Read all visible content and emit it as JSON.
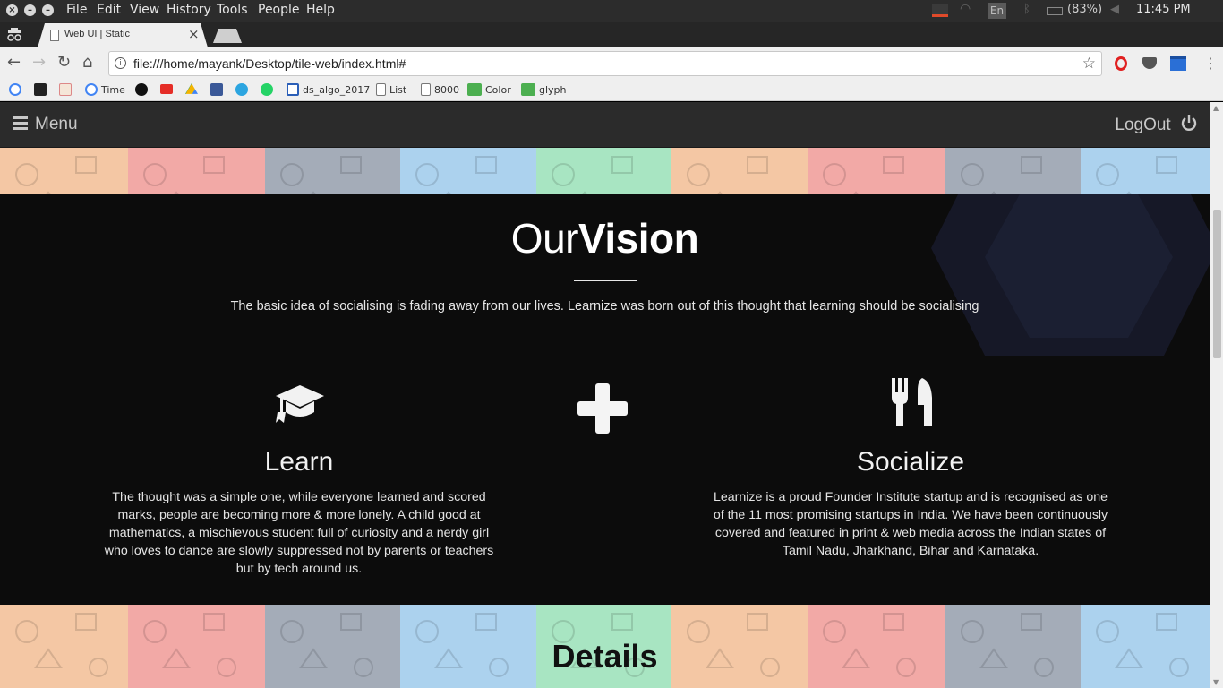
{
  "os_bar": {
    "menu": [
      "File",
      "Edit",
      "View",
      "History",
      "Tools",
      "People",
      "Help"
    ],
    "keyboard_layout": "En",
    "battery": "(83%)",
    "clock": "11:45 PM"
  },
  "browser": {
    "tab_title": "Web UI | Static",
    "url": "file:///home/mayank/Desktop/tile-web/index.html#",
    "bookmarks": [
      {
        "label": "",
        "icon": "google-icon"
      },
      {
        "label": "",
        "icon": "bookmark-slash-icon"
      },
      {
        "label": "",
        "icon": "backpack-icon"
      },
      {
        "label": "Time",
        "icon": "google-icon"
      },
      {
        "label": "",
        "icon": "github-icon"
      },
      {
        "label": "",
        "icon": "youtube-icon"
      },
      {
        "label": "",
        "icon": "drive-icon"
      },
      {
        "label": "",
        "icon": "facebook-icon"
      },
      {
        "label": "",
        "icon": "telegram-icon"
      },
      {
        "label": "",
        "icon": "whatsapp-icon"
      },
      {
        "label": "ds_algo_2017",
        "icon": "doc-icon"
      },
      {
        "label": "List",
        "icon": "page-icon"
      },
      {
        "label": "8000",
        "icon": "page-icon"
      },
      {
        "label": "Color",
        "icon": "w3-icon"
      },
      {
        "label": "glyph",
        "icon": "w3-icon"
      }
    ]
  },
  "site": {
    "nav": {
      "menu_label": "Menu",
      "logout_label": "LogOut"
    },
    "vision": {
      "title_light": "Our",
      "title_bold": "Vision",
      "subtitle": "The basic idea of socialising is fading away from our lives. Learnize was born out of this thought that learning should be socialising",
      "learn": {
        "title": "Learn",
        "lines": [
          "The thought was a simple one, while everyone learned and scored",
          "marks, people are becoming more & more lonely. A child good at",
          "mathematics, a mischievous student full of curiosity and a nerdy girl",
          "who loves to dance are slowly suppressed not by parents or teachers",
          "but by tech around us."
        ]
      },
      "socialize": {
        "title": "Socialize",
        "lines": [
          "Learnize is a proud Founder Institute startup and is recognised as one",
          "of the 11 most promising startups in India. We have been continuously",
          "covered and featured in print & web media across the Indian states of",
          "Tamil Nadu, Jharkhand, Bihar and Karnataka."
        ]
      }
    },
    "details": {
      "title": "Details"
    },
    "tile_colors": [
      "#f4c7a4",
      "#f2a9a6",
      "#a4acb8",
      "#acd2ee",
      "#a8e5c2",
      "#f4c7a4",
      "#f2a9a6",
      "#a4acb8",
      "#acd2ee"
    ]
  }
}
